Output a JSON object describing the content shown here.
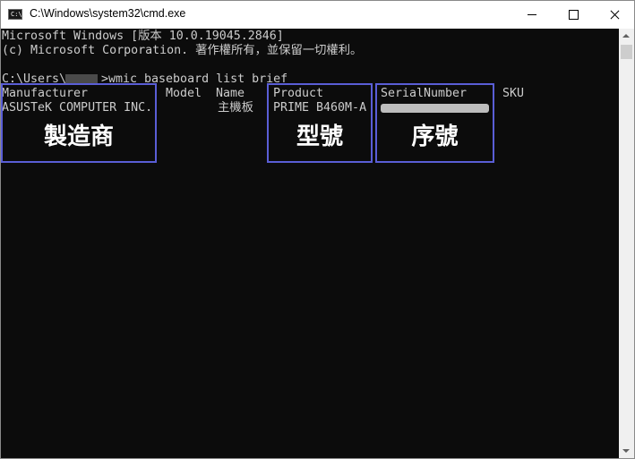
{
  "window": {
    "title": "C:\\Windows\\system32\\cmd.exe",
    "icon_text": "C:\\"
  },
  "console": {
    "lines": [
      "Microsoft Windows [版本 10.0.19045.2846]",
      "(c) Microsoft Corporation. 著作權所有，並保留一切權利。",
      "",
      "C:\\Users\\",
      ">wmic baseboard list brief"
    ],
    "headers": {
      "manufacturer": "Manufacturer",
      "model": "Model",
      "name": "Name",
      "product": "Product",
      "serial": "SerialNumber",
      "sku": "SKU"
    },
    "values": {
      "manufacturer": "ASUSTeK COMPUTER INC.",
      "name": "主機板",
      "product": "PRIME B460M-A"
    }
  },
  "annotations": {
    "manufacturer": "製造商",
    "product": "型號",
    "serial": "序號"
  },
  "colors": {
    "console_bg": "#0c0c0c",
    "console_text": "#cccccc",
    "annotation_border": "#5a5ed6"
  },
  "icons": {
    "window_icon": "cmd-icon",
    "minimize": "minimize-icon",
    "maximize": "maximize-icon",
    "close": "close-icon"
  }
}
